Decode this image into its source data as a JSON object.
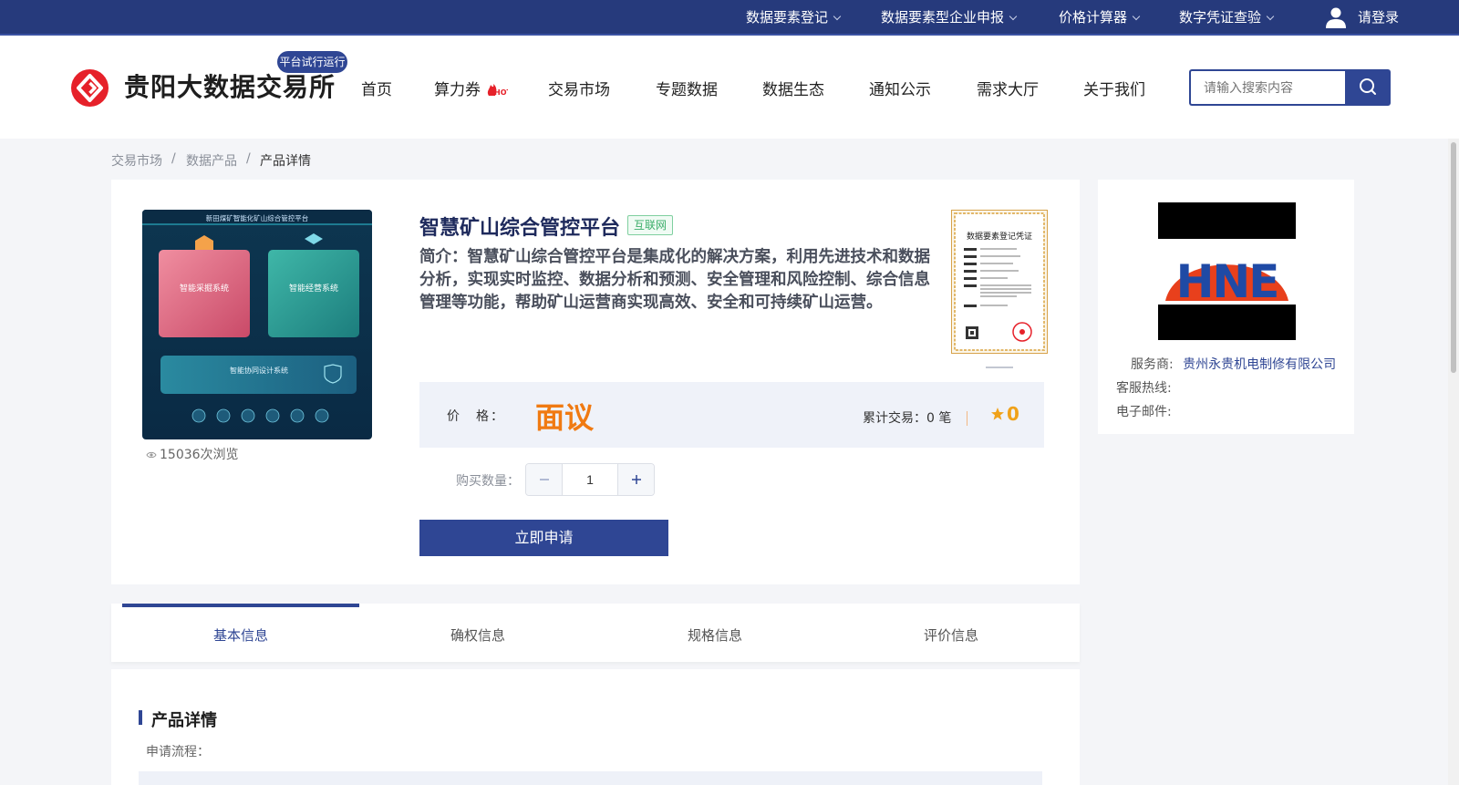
{
  "topbar": {
    "items": [
      {
        "label": "数据要素登记"
      },
      {
        "label": "数据要素型企业申报"
      },
      {
        "label": "价格计算器"
      },
      {
        "label": "数字凭证查验"
      }
    ],
    "login_label": "请登录"
  },
  "header": {
    "logo_text": "贵阳大数据交易所",
    "trial_badge": "平台试行运行",
    "nav": [
      "首页",
      "算力券",
      "交易市场",
      "专题数据",
      "数据生态",
      "通知公示",
      "需求大厅",
      "关于我们"
    ],
    "hot_badge": "HOT",
    "search_placeholder": "请输入搜索内容"
  },
  "breadcrumb": [
    "交易市场",
    "数据产品",
    "产品详情"
  ],
  "breadcrumb_sep": "/",
  "product": {
    "image_labels": [
      "新田煤矿智能化矿山综合管控平台",
      "智能采掘系统",
      "智能经营系统",
      "智能协同设计系统"
    ],
    "views": "15036次浏览",
    "title": "智慧矿山综合管控平台",
    "tag": "互联网",
    "description": "简介：智慧矿山综合管控平台是集成化的解决方案，利用先进技术和数据分析，实现实时监控、数据分析和预测、安全管理和风险控制、综合信息管理等功能，帮助矿山运营商实现高效、安全和可持续矿山运营。",
    "certificate_title": "数据要素登记凭证",
    "price_label": "价　格：",
    "price_value": "面议",
    "deals": "累计交易：0 笔",
    "rating": "0",
    "qty_label": "购买数量：",
    "qty_value": "1",
    "apply_label": "立即申请"
  },
  "vendor": {
    "logo_text": "HNE",
    "provider_label": "服务商:",
    "provider_name": "贵州永贵机电制修有限公司",
    "hotline_label": "客服热线:",
    "email_label": "电子邮件:"
  },
  "tabs": [
    {
      "label": "基本信息",
      "active": true
    },
    {
      "label": "确权信息",
      "active": false
    },
    {
      "label": "规格信息",
      "active": false
    },
    {
      "label": "评价信息",
      "active": false
    }
  ],
  "detail": {
    "title": "产品详情",
    "flow_label": "申请流程："
  },
  "colors": {
    "brand_navy": "#263a7c",
    "primary_blue": "#2f4694",
    "price_orange": "#f07a12",
    "rating_gold": "#f0a21a",
    "logo_red": "#e6212a",
    "tag_green": "#3cae6a"
  },
  "icons": [
    "chevron-down-icon",
    "user-icon",
    "search-icon",
    "hot-flame-icon",
    "eye-icon",
    "star-icon",
    "minus-icon",
    "plus-icon"
  ]
}
